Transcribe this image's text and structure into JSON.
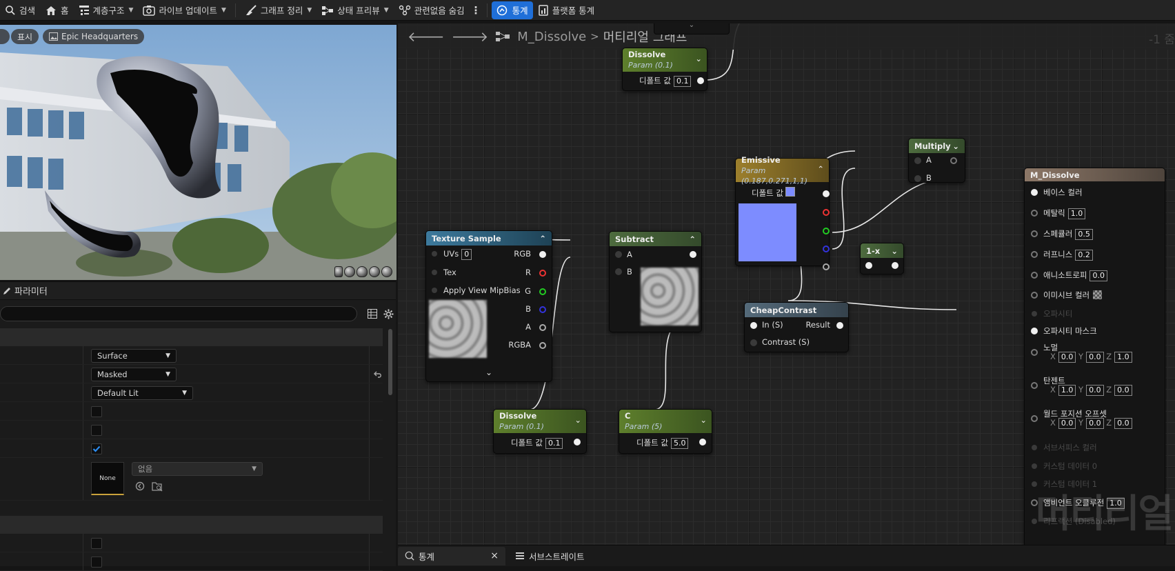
{
  "toolbar": {
    "items": [
      {
        "label": "검색",
        "icon": "search-icon"
      },
      {
        "label": "홈",
        "icon": "home-icon"
      },
      {
        "label": "계층구조",
        "icon": "hierarchy-icon"
      },
      {
        "label": "라이브 업데이트",
        "icon": "live-update-icon"
      },
      {
        "label": "그래프 정리",
        "icon": "broom-icon"
      },
      {
        "label": "상태 프리뷰",
        "icon": "preview-icon"
      },
      {
        "label": "관련없음 숨김",
        "icon": "hide-unrelated-icon"
      },
      {
        "label": "통계",
        "icon": "stats-icon",
        "active": true
      },
      {
        "label": "플랫폼 통계",
        "icon": "platform-stats-icon"
      }
    ]
  },
  "viewport": {
    "show_label": "표시",
    "camera_label": "Epic Headquarters",
    "preview_shapes": [
      "sphere",
      "cube",
      "plane",
      "cylinder",
      "custom"
    ]
  },
  "details": {
    "title": "파라미터",
    "rows": {
      "domain": "Surface",
      "blend_mode": "Masked",
      "shading_model": "Default Lit",
      "check1": false,
      "check2": false,
      "check3": true,
      "texture_thumb": "None",
      "texture_dropdown": "없음"
    }
  },
  "graph": {
    "breadcrumb_asset": "M_Dissolve",
    "breadcrumb_sep": ">",
    "breadcrumb_page": "머티리얼 그래프",
    "zoom": "-1 줌",
    "watermark": "머티리얼",
    "nodes": {
      "dissolve_top": {
        "title": "Dissolve",
        "sub": "Param (0.1)",
        "default_label": "디폴트 값",
        "value": "0.1"
      },
      "emissive": {
        "title": "Emissive",
        "sub": "Param (0.187,0.271,1,1)",
        "default_label": "디폴트 값",
        "color": "#7d8cff"
      },
      "multiply": {
        "title": "Multiply",
        "a": "A",
        "b": "B"
      },
      "texture_sample": {
        "title": "Texture Sample",
        "uvs": "UVs",
        "uvs_value": "0",
        "tex": "Tex",
        "mipbias": "Apply View MipBias",
        "outputs": [
          "RGB",
          "R",
          "G",
          "B",
          "A",
          "RGBA"
        ]
      },
      "subtract": {
        "title": "Subtract",
        "a": "A",
        "b": "B"
      },
      "cheap_contrast": {
        "title": "CheapContrast",
        "in": "In (S)",
        "result": "Result",
        "contrast": "Contrast (S)"
      },
      "one_minus_x": {
        "title": "1-x"
      },
      "dissolve_bottom": {
        "title": "Dissolve",
        "sub": "Param (0.1)",
        "default_label": "디폴트 값",
        "value": "0.1"
      },
      "c_param": {
        "title": "C",
        "sub": "Param (5)",
        "default_label": "디폴트 값",
        "value": "5.0"
      },
      "result": {
        "title": "M_Dissolve",
        "base_color": "베이스 컬러",
        "metallic": "메탈릭",
        "metallic_v": "1.0",
        "specular": "스페큘러",
        "specular_v": "0.5",
        "roughness": "러프니스",
        "roughness_v": "0.2",
        "anisotropy": "애니소트로피",
        "anisotropy_v": "0.0",
        "emissive": "이미시브 컬러",
        "opacity": "오파시티",
        "opacity_mask": "오파시티 마스크",
        "normal": "노멀",
        "normal_x": "0.0",
        "normal_y": "0.0",
        "normal_z": "1.0",
        "tangent": "탄젠트",
        "tangent_x": "1.0",
        "tangent_y": "0.0",
        "tangent_z": "0.0",
        "wpo": "월드 포지션 오프셋",
        "wpo_x": "0.0",
        "wpo_y": "0.0",
        "wpo_z": "0.0",
        "subsurface": "서브서피스 컬러",
        "custom0": "커스텀 데이터 0",
        "custom1": "커스텀 데이터 1",
        "ao": "앰비언트 오클루전",
        "ao_v": "1.0",
        "refraction": "리프랙션 (Disabled)",
        "axis_x": "X",
        "axis_y": "Y",
        "axis_z": "Z"
      }
    }
  },
  "bottom_tabs": {
    "stats": "통계",
    "close": "×",
    "substrate": "서브스트레이트"
  }
}
